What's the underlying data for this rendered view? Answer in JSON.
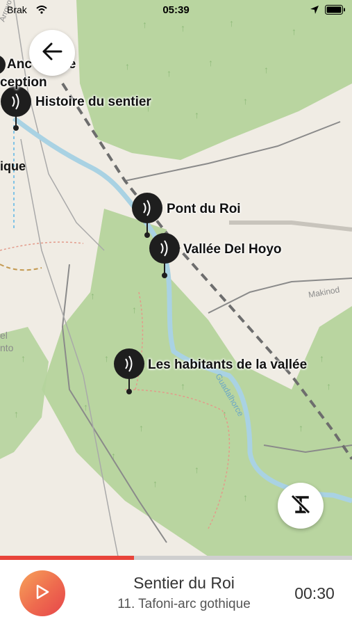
{
  "status_bar": {
    "carrier": "Brak",
    "time": "05:39"
  },
  "map": {
    "pois": [
      {
        "label": "Anc  arrage",
        "label2": "ception"
      },
      {
        "label": "Histoire du sentier"
      },
      {
        "label": "Pont du Roi"
      },
      {
        "label": "Vallée Del Hoyo"
      },
      {
        "label": "Les habitants de la vallée"
      }
    ],
    "edge_labels": {
      "left_1": "ique",
      "left_2": "el",
      "left_3": "nto"
    },
    "street_labels": [
      "Makinod",
      "Guadalhorce",
      "Arroyo de las Dales"
    ]
  },
  "player": {
    "title": "Sentier du Roi",
    "subtitle": "11. Tafoni-arc gothique",
    "duration": "00:30",
    "progress": 0.38
  }
}
